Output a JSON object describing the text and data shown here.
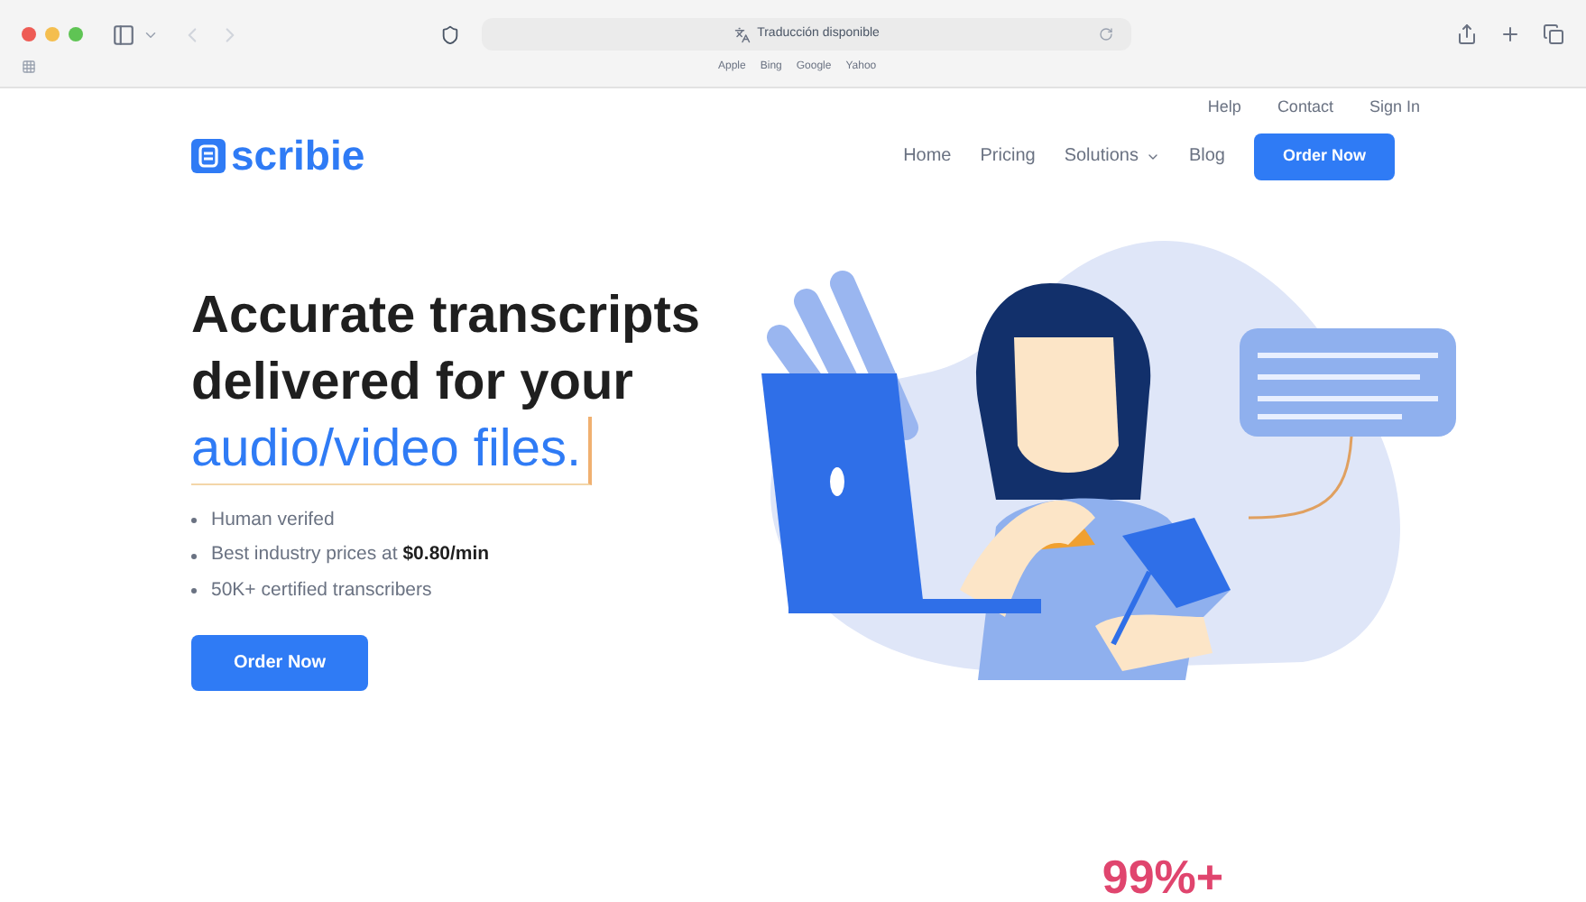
{
  "browser": {
    "address": "Traducción disponible",
    "bookmarks": [
      "Apple",
      "Bing",
      "Google",
      "Yahoo"
    ]
  },
  "top_links": [
    "Help",
    "Contact",
    "Sign In"
  ],
  "logo": "scribie",
  "nav": [
    {
      "label": "Home",
      "kind": "link"
    },
    {
      "label": "Pricing",
      "kind": "link"
    },
    {
      "label": "Solutions",
      "kind": "dropdown"
    },
    {
      "label": "Blog",
      "kind": "link"
    },
    {
      "label": "Order Now",
      "kind": "button"
    }
  ],
  "hero": {
    "heading_lines": [
      "Accurate transcripts",
      "delivered for your"
    ],
    "heading_highlight": "audio/video files.",
    "bullets": [
      "Human verifed",
      "Best industry prices at **$0.80/min**",
      "50K+ certified transcribers"
    ],
    "button": "Order Now"
  },
  "stat": "99%+"
}
